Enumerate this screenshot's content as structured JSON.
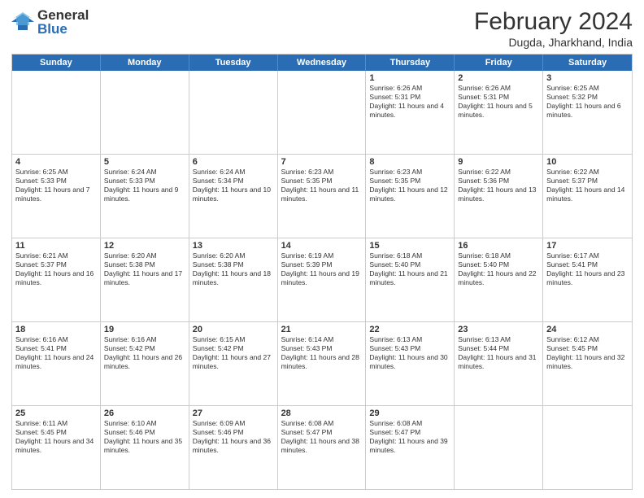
{
  "header": {
    "logo_general": "General",
    "logo_blue": "Blue",
    "month_year": "February 2024",
    "location": "Dugda, Jharkhand, India"
  },
  "calendar": {
    "days_of_week": [
      "Sunday",
      "Monday",
      "Tuesday",
      "Wednesday",
      "Thursday",
      "Friday",
      "Saturday"
    ],
    "rows": [
      [
        {
          "day": "",
          "info": "",
          "empty": true
        },
        {
          "day": "",
          "info": "",
          "empty": true
        },
        {
          "day": "",
          "info": "",
          "empty": true
        },
        {
          "day": "",
          "info": "",
          "empty": true
        },
        {
          "day": "1",
          "info": "Sunrise: 6:26 AM\nSunset: 5:31 PM\nDaylight: 11 hours and 4 minutes.",
          "empty": false
        },
        {
          "day": "2",
          "info": "Sunrise: 6:26 AM\nSunset: 5:31 PM\nDaylight: 11 hours and 5 minutes.",
          "empty": false
        },
        {
          "day": "3",
          "info": "Sunrise: 6:25 AM\nSunset: 5:32 PM\nDaylight: 11 hours and 6 minutes.",
          "empty": false
        }
      ],
      [
        {
          "day": "4",
          "info": "Sunrise: 6:25 AM\nSunset: 5:33 PM\nDaylight: 11 hours and 7 minutes.",
          "empty": false
        },
        {
          "day": "5",
          "info": "Sunrise: 6:24 AM\nSunset: 5:33 PM\nDaylight: 11 hours and 9 minutes.",
          "empty": false
        },
        {
          "day": "6",
          "info": "Sunrise: 6:24 AM\nSunset: 5:34 PM\nDaylight: 11 hours and 10 minutes.",
          "empty": false
        },
        {
          "day": "7",
          "info": "Sunrise: 6:23 AM\nSunset: 5:35 PM\nDaylight: 11 hours and 11 minutes.",
          "empty": false
        },
        {
          "day": "8",
          "info": "Sunrise: 6:23 AM\nSunset: 5:35 PM\nDaylight: 11 hours and 12 minutes.",
          "empty": false
        },
        {
          "day": "9",
          "info": "Sunrise: 6:22 AM\nSunset: 5:36 PM\nDaylight: 11 hours and 13 minutes.",
          "empty": false
        },
        {
          "day": "10",
          "info": "Sunrise: 6:22 AM\nSunset: 5:37 PM\nDaylight: 11 hours and 14 minutes.",
          "empty": false
        }
      ],
      [
        {
          "day": "11",
          "info": "Sunrise: 6:21 AM\nSunset: 5:37 PM\nDaylight: 11 hours and 16 minutes.",
          "empty": false
        },
        {
          "day": "12",
          "info": "Sunrise: 6:20 AM\nSunset: 5:38 PM\nDaylight: 11 hours and 17 minutes.",
          "empty": false
        },
        {
          "day": "13",
          "info": "Sunrise: 6:20 AM\nSunset: 5:38 PM\nDaylight: 11 hours and 18 minutes.",
          "empty": false
        },
        {
          "day": "14",
          "info": "Sunrise: 6:19 AM\nSunset: 5:39 PM\nDaylight: 11 hours and 19 minutes.",
          "empty": false
        },
        {
          "day": "15",
          "info": "Sunrise: 6:18 AM\nSunset: 5:40 PM\nDaylight: 11 hours and 21 minutes.",
          "empty": false
        },
        {
          "day": "16",
          "info": "Sunrise: 6:18 AM\nSunset: 5:40 PM\nDaylight: 11 hours and 22 minutes.",
          "empty": false
        },
        {
          "day": "17",
          "info": "Sunrise: 6:17 AM\nSunset: 5:41 PM\nDaylight: 11 hours and 23 minutes.",
          "empty": false
        }
      ],
      [
        {
          "day": "18",
          "info": "Sunrise: 6:16 AM\nSunset: 5:41 PM\nDaylight: 11 hours and 24 minutes.",
          "empty": false
        },
        {
          "day": "19",
          "info": "Sunrise: 6:16 AM\nSunset: 5:42 PM\nDaylight: 11 hours and 26 minutes.",
          "empty": false
        },
        {
          "day": "20",
          "info": "Sunrise: 6:15 AM\nSunset: 5:42 PM\nDaylight: 11 hours and 27 minutes.",
          "empty": false
        },
        {
          "day": "21",
          "info": "Sunrise: 6:14 AM\nSunset: 5:43 PM\nDaylight: 11 hours and 28 minutes.",
          "empty": false
        },
        {
          "day": "22",
          "info": "Sunrise: 6:13 AM\nSunset: 5:43 PM\nDaylight: 11 hours and 30 minutes.",
          "empty": false
        },
        {
          "day": "23",
          "info": "Sunrise: 6:13 AM\nSunset: 5:44 PM\nDaylight: 11 hours and 31 minutes.",
          "empty": false
        },
        {
          "day": "24",
          "info": "Sunrise: 6:12 AM\nSunset: 5:45 PM\nDaylight: 11 hours and 32 minutes.",
          "empty": false
        }
      ],
      [
        {
          "day": "25",
          "info": "Sunrise: 6:11 AM\nSunset: 5:45 PM\nDaylight: 11 hours and 34 minutes.",
          "empty": false
        },
        {
          "day": "26",
          "info": "Sunrise: 6:10 AM\nSunset: 5:46 PM\nDaylight: 11 hours and 35 minutes.",
          "empty": false
        },
        {
          "day": "27",
          "info": "Sunrise: 6:09 AM\nSunset: 5:46 PM\nDaylight: 11 hours and 36 minutes.",
          "empty": false
        },
        {
          "day": "28",
          "info": "Sunrise: 6:08 AM\nSunset: 5:47 PM\nDaylight: 11 hours and 38 minutes.",
          "empty": false
        },
        {
          "day": "29",
          "info": "Sunrise: 6:08 AM\nSunset: 5:47 PM\nDaylight: 11 hours and 39 minutes.",
          "empty": false
        },
        {
          "day": "",
          "info": "",
          "empty": true
        },
        {
          "day": "",
          "info": "",
          "empty": true
        }
      ]
    ]
  }
}
